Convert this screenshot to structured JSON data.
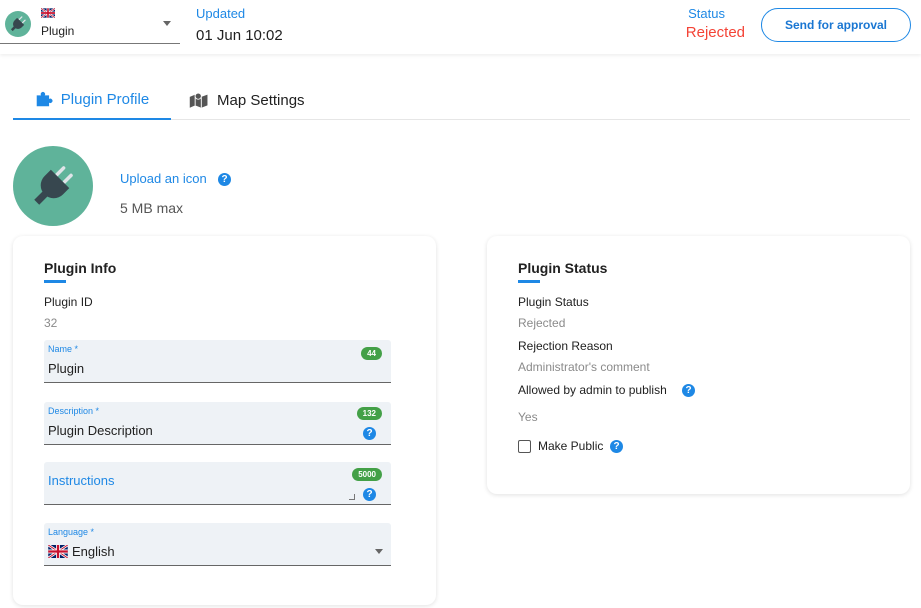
{
  "header": {
    "plugin_select": {
      "value": "Plugin"
    },
    "updated_label": "Updated",
    "updated_value": "01 Jun 10:02",
    "status_label": "Status",
    "status_value": "Rejected",
    "approve_button": "Send for approval"
  },
  "tabs": [
    {
      "label": "Plugin Profile",
      "active": true
    },
    {
      "label": "Map Settings",
      "active": false
    }
  ],
  "icon_upload": {
    "link": "Upload an icon",
    "max": "5 MB max"
  },
  "plugin_info": {
    "title": "Plugin Info",
    "id_label": "Plugin ID",
    "id_value": "32",
    "name": {
      "label": "Name *",
      "value": "Plugin",
      "counter": "44"
    },
    "description": {
      "label": "Description *",
      "value": "Plugin Description",
      "counter": "132"
    },
    "instructions": {
      "placeholder": "Instructions",
      "counter": "5000"
    },
    "language": {
      "label": "Language *",
      "value": "English"
    }
  },
  "plugin_status": {
    "title": "Plugin Status",
    "status_label": "Plugin Status",
    "status_value": "Rejected",
    "reason_label": "Rejection Reason",
    "reason_value": "Administrator's comment",
    "allowed_label": "Allowed by admin to publish",
    "allowed_value": "Yes",
    "make_public_label": "Make Public"
  },
  "colors": {
    "accent": "#1e88e5",
    "rejected": "#f44336",
    "counter_badge": "#43a047",
    "avatar": "#5fb39a"
  },
  "icons": [
    "plug-icon",
    "uk-flag-icon",
    "puzzle-icon",
    "map-icon",
    "help-icon",
    "chevron-down-icon"
  ]
}
